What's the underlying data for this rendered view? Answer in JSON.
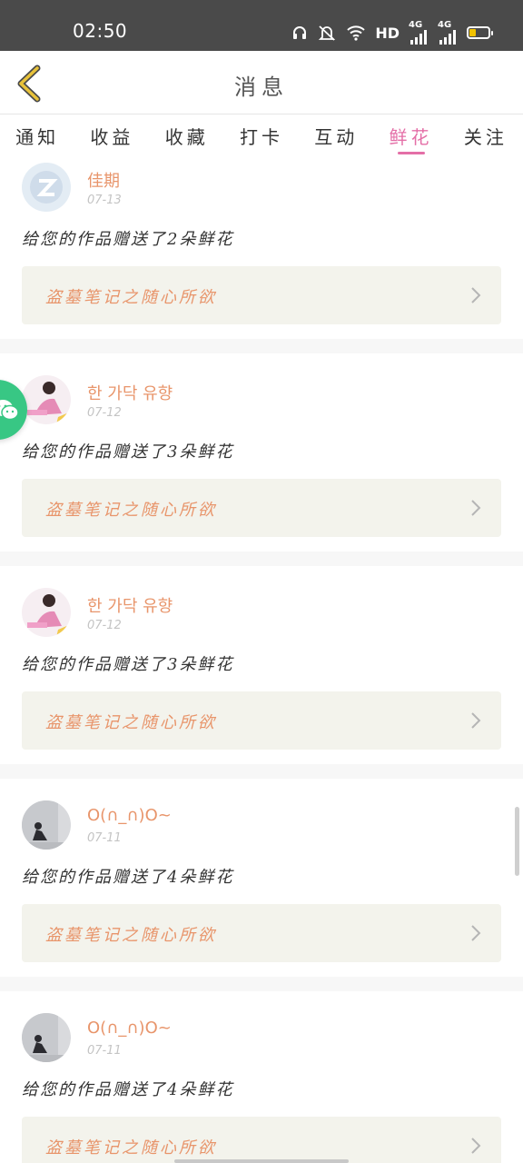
{
  "status_bar": {
    "time": "02:50",
    "hd_label": "HD",
    "net1": "4G",
    "net2": "4G",
    "battery_level": 0.3,
    "battery_color": "#f2c200",
    "icons": [
      "headphones-icon",
      "mute-icon",
      "wifi-icon",
      "signal-icon",
      "signal-icon",
      "battery-icon"
    ]
  },
  "header": {
    "title": "消息",
    "back_icon": "chevron-left-icon",
    "accent": "#e8c23a"
  },
  "tabs": [
    {
      "label": "通知",
      "active": false
    },
    {
      "label": "收益",
      "active": false
    },
    {
      "label": "收藏",
      "active": false
    },
    {
      "label": "打卡",
      "active": false
    },
    {
      "label": "互动",
      "active": false
    },
    {
      "label": "鲜花",
      "active": true
    },
    {
      "label": "关注",
      "active": false
    }
  ],
  "active_color": "#e46fa7",
  "messages": [
    {
      "name": "佳期",
      "date": "07-13",
      "text": "给您的作品赠送了2朵鲜花",
      "work_title": "盗墓笔记之随心所欲"
    },
    {
      "name": "한 가닥 유향",
      "date": "07-12",
      "text": "给您的作品赠送了3朵鲜花",
      "work_title": "盗墓笔记之随心所欲"
    },
    {
      "name": "한 가닥 유향",
      "date": "07-12",
      "text": "给您的作品赠送了3朵鲜花",
      "work_title": "盗墓笔记之随心所欲"
    },
    {
      "name": "O(∩_∩)O~",
      "date": "07-11",
      "text": "给您的作品赠送了4朵鲜花",
      "work_title": "盗墓笔记之随心所欲"
    },
    {
      "name": "O(∩_∩)O~",
      "date": "07-11",
      "text": "给您的作品赠送了4朵鲜花",
      "work_title": "盗墓笔记之随心所欲"
    }
  ],
  "name_color": "#e8956b",
  "float_button": {
    "icon": "wechat-icon",
    "color": "#38c784"
  }
}
